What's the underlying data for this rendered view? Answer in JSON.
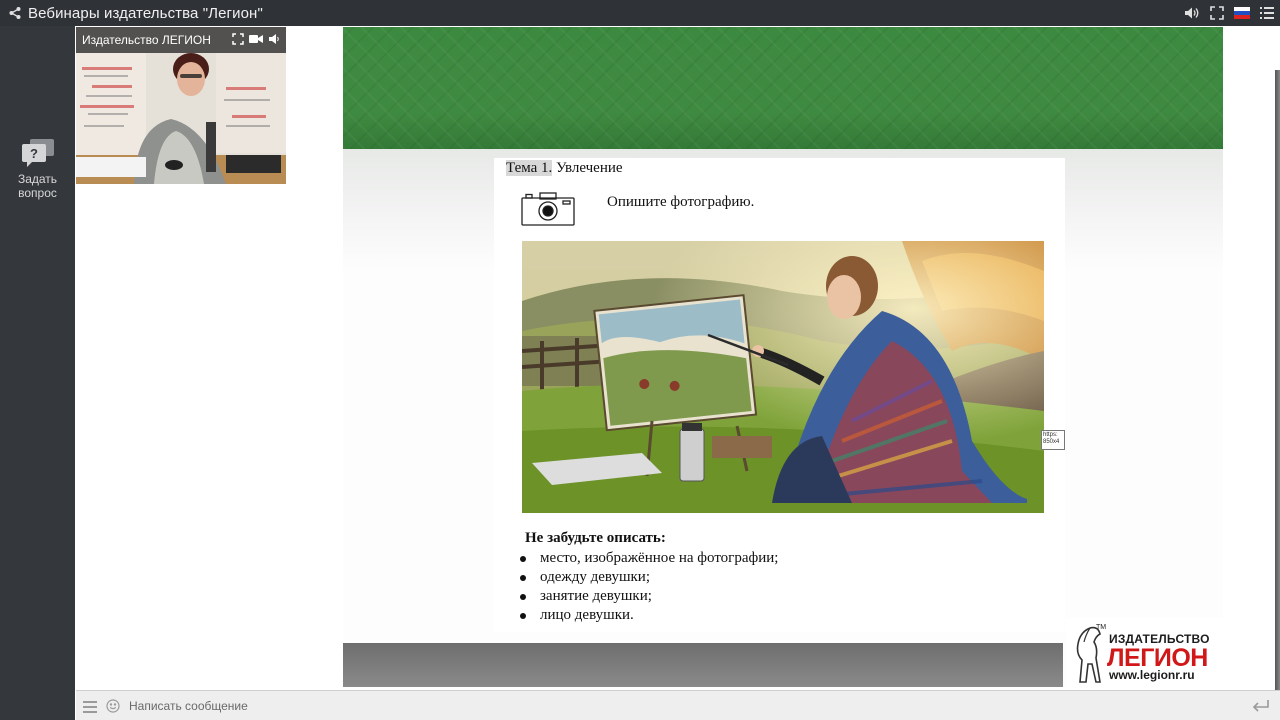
{
  "window": {
    "title": "Вебинары издательства \"Легион\""
  },
  "sidebar": {
    "ask_label_1": "Задать",
    "ask_label_2": "вопрос"
  },
  "webcam": {
    "label": "Издательство ЛЕГИОН"
  },
  "slide": {
    "topic_prefix": "Тема 1.",
    "topic_title": "Увлечение",
    "prompt": "Опишите фотографию.",
    "reminder_title": "Не забудьте описать:",
    "bullets": [
      "место, изображённое на фотографии;",
      "одежду девушки;",
      "занятие девушки;",
      "лицо девушки."
    ],
    "link_text": "https: 850x4"
  },
  "logo": {
    "tm": "ТМ",
    "line1": "ИЗДАТЕЛЬСТВО",
    "line2": "ЛЕГИОН",
    "line3": "www.legionr.ru"
  },
  "chat": {
    "placeholder": "Написать сообщение"
  },
  "colors": {
    "topbar": "#2f3237",
    "sidebar": "#34373c",
    "slide_green": "#3f8a41",
    "logo_red": "#d01818"
  }
}
